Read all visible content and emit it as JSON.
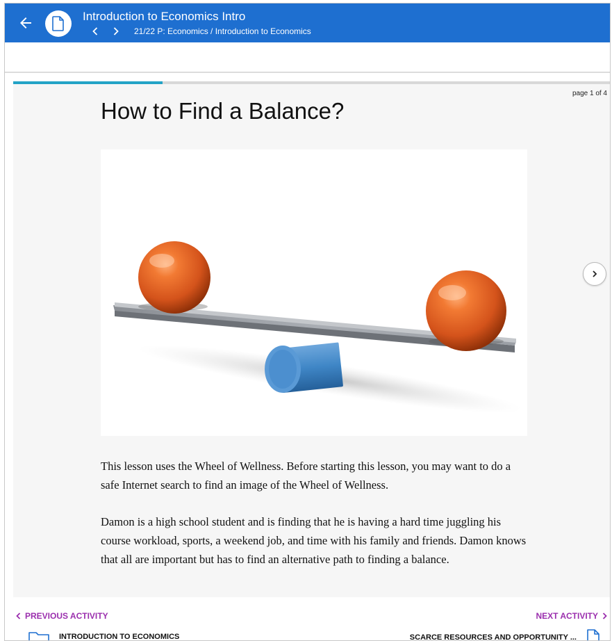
{
  "header": {
    "title": "Introduction to Economics Intro",
    "breadcrumb": "21/22 P: Economics / Introduction to Economics"
  },
  "page": {
    "indicator": "page 1 of 4",
    "progress_fraction": 0.25,
    "heading": "How to Find a Balance?",
    "image_alt": "Orange spheres balanced on a seesaw",
    "paragraph1": "This lesson uses the Wheel of Wellness. Before starting this lesson, you may want to do a safe Internet search to find an image of the Wheel of Wellness.",
    "paragraph2": "Damon is a high school student and is finding that he is having a hard time juggling his course workload, sports, a weekend job, and time with his family and friends. Damon knows that all are important but has to find an alternative path to finding a balance."
  },
  "footer": {
    "previous_label": "PREVIOUS ACTIVITY",
    "previous_title": "INTRODUCTION TO ECONOMICS",
    "next_label": "NEXT ACTIVITY",
    "next_title": "SCARCE RESOURCES AND OPPORTUNITY ..."
  },
  "colors": {
    "topbar": "#1e6fd0",
    "progress": "#23a3c6",
    "link": "#9b2fae",
    "sphere": "#e0601f",
    "cylinder": "#3f86c6"
  },
  "icons": {
    "back": "arrow-left-icon",
    "document": "document-icon",
    "prev": "chevron-left-icon",
    "next": "chevron-right-icon",
    "folder": "folder-icon"
  }
}
